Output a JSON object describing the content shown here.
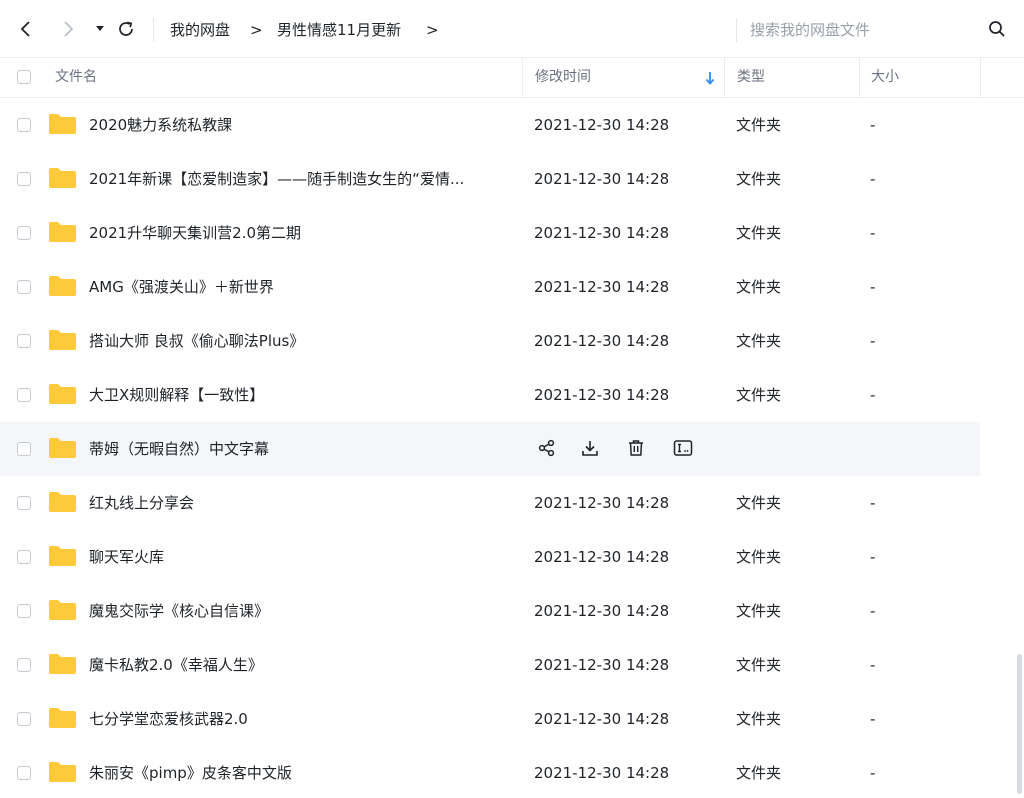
{
  "toolbar": {
    "back_icon": "chevron-left-icon",
    "forward_icon": "chevron-right-icon",
    "dropdown_icon": "caret-down-icon",
    "refresh_icon": "refresh-icon"
  },
  "breadcrumb": {
    "root": "我的网盘",
    "separator": ">",
    "current": "男性情感11月更新",
    "trailing_separator": ">"
  },
  "search": {
    "placeholder": "搜索我的网盘文件",
    "value": "",
    "icon": "search-icon"
  },
  "columns": {
    "name": "文件名",
    "modified": "修改时间",
    "type": "类型",
    "size": "大小",
    "sort_icon": "arrow-down-icon"
  },
  "accent_color": "#2b8ff0",
  "folder_color": "#ffc93c",
  "files": [
    {
      "name": "2020魅力系统私教課",
      "date": "2021-12-30 14:28",
      "type": "文件夹",
      "size": "-"
    },
    {
      "name": "2021年新课【恋爱制造家】——随手制造女生的“爱情...",
      "date": "2021-12-30 14:28",
      "type": "文件夹",
      "size": "-"
    },
    {
      "name": "2021升华聊天集训营2.0第二期",
      "date": "2021-12-30 14:28",
      "type": "文件夹",
      "size": "-"
    },
    {
      "name": "AMG《强渡关山》＋新世界",
      "date": "2021-12-30 14:28",
      "type": "文件夹",
      "size": "-"
    },
    {
      "name": "搭讪大师 良叔《偷心聊法Plus》",
      "date": "2021-12-30 14:28",
      "type": "文件夹",
      "size": "-"
    },
    {
      "name": "大卫X规则解释【一致性】",
      "date": "2021-12-30 14:28",
      "type": "文件夹",
      "size": "-"
    },
    {
      "name": "蒂姆（无暇自然）中文字幕",
      "date": "",
      "type": "",
      "size": ""
    },
    {
      "name": "红丸线上分享会",
      "date": "2021-12-30 14:28",
      "type": "文件夹",
      "size": "-"
    },
    {
      "name": "聊天军火库",
      "date": "2021-12-30 14:28",
      "type": "文件夹",
      "size": "-"
    },
    {
      "name": "魔鬼交际学《核心自信课》",
      "date": "2021-12-30 14:28",
      "type": "文件夹",
      "size": "-"
    },
    {
      "name": "魔卡私教2.0《幸福人生》",
      "date": "2021-12-30 14:28",
      "type": "文件夹",
      "size": "-"
    },
    {
      "name": "七分学堂恋爱核武器2.0",
      "date": "2021-12-30 14:28",
      "type": "文件夹",
      "size": "-"
    },
    {
      "name": "朱丽安《pimp》皮条客中文版",
      "date": "2021-12-30 14:28",
      "type": "文件夹",
      "size": "-"
    }
  ],
  "row_actions": [
    "share-icon",
    "download-icon",
    "delete-icon",
    "rename-icon"
  ]
}
